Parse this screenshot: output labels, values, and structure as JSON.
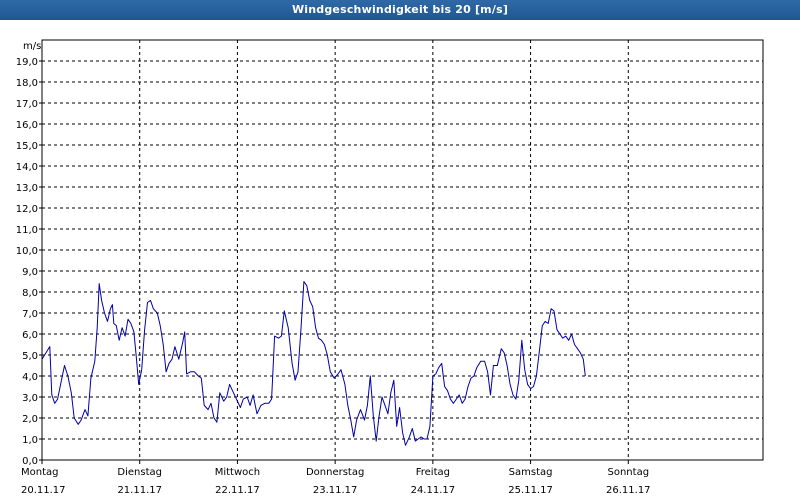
{
  "window": {
    "title": "Windgeschwindigkeit bis 20 [m/s]"
  },
  "colors": {
    "title_bar": "#1f5793",
    "series": "#0000aa",
    "grid": "#000000",
    "background": "#ffffff"
  },
  "chart_data": {
    "type": "line",
    "ylabel": "m/s",
    "ylim": [
      0,
      20
    ],
    "yticks": [
      "0,0",
      "1,0",
      "2,0",
      "3,0",
      "4,0",
      "5,0",
      "6,0",
      "7,0",
      "8,0",
      "9,0",
      "10,0",
      "11,0",
      "12,0",
      "13,0",
      "14,0",
      "15,0",
      "16,0",
      "17,0",
      "18,0",
      "19,0"
    ],
    "xlim": [
      0,
      7
    ],
    "xtick_days": [
      "Montag",
      "Dienstag",
      "Mittwoch",
      "Donnerstag",
      "Freitag",
      "Samstag",
      "Sonntag"
    ],
    "xtick_dates": [
      "20.11.17",
      "21.11.17",
      "22.11.17",
      "23.11.17",
      "24.11.17",
      "25.11.17",
      "26.11.17"
    ],
    "grid": true,
    "series": [
      {
        "values": [
          [
            0.0,
            4.8
          ],
          [
            0.04,
            5.1
          ],
          [
            0.08,
            5.4
          ],
          [
            0.1,
            3.1
          ],
          [
            0.13,
            2.7
          ],
          [
            0.16,
            2.9
          ],
          [
            0.19,
            3.6
          ],
          [
            0.23,
            4.5
          ],
          [
            0.265,
            4.0
          ],
          [
            0.3,
            3.2
          ],
          [
            0.33,
            2.0
          ],
          [
            0.37,
            1.7
          ],
          [
            0.4,
            1.9
          ],
          [
            0.44,
            2.4
          ],
          [
            0.47,
            2.1
          ],
          [
            0.5,
            3.9
          ],
          [
            0.54,
            4.7
          ],
          [
            0.565,
            6.3
          ],
          [
            0.585,
            8.4
          ],
          [
            0.61,
            7.6
          ],
          [
            0.64,
            7.0
          ],
          [
            0.67,
            6.6
          ],
          [
            0.7,
            7.2
          ],
          [
            0.72,
            7.4
          ],
          [
            0.735,
            6.5
          ],
          [
            0.76,
            6.4
          ],
          [
            0.79,
            5.7
          ],
          [
            0.82,
            6.3
          ],
          [
            0.85,
            5.9
          ],
          [
            0.88,
            6.7
          ],
          [
            0.91,
            6.5
          ],
          [
            0.94,
            6.1
          ],
          [
            0.965,
            4.9
          ],
          [
            0.99,
            3.6
          ],
          [
            1.02,
            4.3
          ],
          [
            1.05,
            6.2
          ],
          [
            1.08,
            7.5
          ],
          [
            1.11,
            7.6
          ],
          [
            1.14,
            7.2
          ],
          [
            1.18,
            7.0
          ],
          [
            1.21,
            6.4
          ],
          [
            1.24,
            5.5
          ],
          [
            1.27,
            4.2
          ],
          [
            1.3,
            4.6
          ],
          [
            1.33,
            4.8
          ],
          [
            1.36,
            5.4
          ],
          [
            1.4,
            4.8
          ],
          [
            1.44,
            5.6
          ],
          [
            1.46,
            6.1
          ],
          [
            1.48,
            4.1
          ],
          [
            1.52,
            4.2
          ],
          [
            1.56,
            4.2
          ],
          [
            1.6,
            4.0
          ],
          [
            1.63,
            3.9
          ],
          [
            1.66,
            2.6
          ],
          [
            1.7,
            2.4
          ],
          [
            1.73,
            2.7
          ],
          [
            1.76,
            2.0
          ],
          [
            1.79,
            1.8
          ],
          [
            1.82,
            3.2
          ],
          [
            1.86,
            2.8
          ],
          [
            1.89,
            3.0
          ],
          [
            1.92,
            3.6
          ],
          [
            1.96,
            3.2
          ],
          [
            2.0,
            2.8
          ],
          [
            2.03,
            2.5
          ],
          [
            2.06,
            2.9
          ],
          [
            2.1,
            3.0
          ],
          [
            2.13,
            2.6
          ],
          [
            2.16,
            3.1
          ],
          [
            2.2,
            2.2
          ],
          [
            2.24,
            2.6
          ],
          [
            2.28,
            2.7
          ],
          [
            2.32,
            2.7
          ],
          [
            2.35,
            2.9
          ],
          [
            2.38,
            5.9
          ],
          [
            2.42,
            5.8
          ],
          [
            2.45,
            5.9
          ],
          [
            2.48,
            7.1
          ],
          [
            2.52,
            6.3
          ],
          [
            2.56,
            4.6
          ],
          [
            2.59,
            3.8
          ],
          [
            2.62,
            4.2
          ],
          [
            2.65,
            6.2
          ],
          [
            2.68,
            8.5
          ],
          [
            2.71,
            8.3
          ],
          [
            2.74,
            7.6
          ],
          [
            2.77,
            7.3
          ],
          [
            2.8,
            6.3
          ],
          [
            2.83,
            5.8
          ],
          [
            2.86,
            5.7
          ],
          [
            2.89,
            5.5
          ],
          [
            2.92,
            5.0
          ],
          [
            2.95,
            4.2
          ],
          [
            2.99,
            3.9
          ],
          [
            3.03,
            4.1
          ],
          [
            3.06,
            4.3
          ],
          [
            3.1,
            3.6
          ],
          [
            3.13,
            2.6
          ],
          [
            3.16,
            1.9
          ],
          [
            3.19,
            1.1
          ],
          [
            3.22,
            1.9
          ],
          [
            3.26,
            2.4
          ],
          [
            3.3,
            1.9
          ],
          [
            3.33,
            2.6
          ],
          [
            3.36,
            4.0
          ],
          [
            3.39,
            2.1
          ],
          [
            3.42,
            0.9
          ],
          [
            3.45,
            2.1
          ],
          [
            3.48,
            3.0
          ],
          [
            3.51,
            2.6
          ],
          [
            3.54,
            2.2
          ],
          [
            3.57,
            3.2
          ],
          [
            3.6,
            3.8
          ],
          [
            3.63,
            1.6
          ],
          [
            3.66,
            2.5
          ],
          [
            3.69,
            1.3
          ],
          [
            3.72,
            0.7
          ],
          [
            3.76,
            1.1
          ],
          [
            3.79,
            1.5
          ],
          [
            3.82,
            0.9
          ],
          [
            3.85,
            1.0
          ],
          [
            3.88,
            1.1
          ],
          [
            3.91,
            1.0
          ],
          [
            3.94,
            1.0
          ],
          [
            3.97,
            1.6
          ],
          [
            4.0,
            4.0
          ],
          [
            4.03,
            4.1
          ],
          [
            4.06,
            4.4
          ],
          [
            4.09,
            4.6
          ],
          [
            4.12,
            3.5
          ],
          [
            4.15,
            3.3
          ],
          [
            4.18,
            2.9
          ],
          [
            4.21,
            2.7
          ],
          [
            4.24,
            2.9
          ],
          [
            4.27,
            3.1
          ],
          [
            4.3,
            2.7
          ],
          [
            4.33,
            2.9
          ],
          [
            4.36,
            3.5
          ],
          [
            4.39,
            3.9
          ],
          [
            4.42,
            4.0
          ],
          [
            4.45,
            4.4
          ],
          [
            4.49,
            4.7
          ],
          [
            4.53,
            4.7
          ],
          [
            4.56,
            4.2
          ],
          [
            4.59,
            3.1
          ],
          [
            4.62,
            4.5
          ],
          [
            4.66,
            4.5
          ],
          [
            4.7,
            5.3
          ],
          [
            4.73,
            5.1
          ],
          [
            4.76,
            4.5
          ],
          [
            4.79,
            3.6
          ],
          [
            4.82,
            3.1
          ],
          [
            4.85,
            2.9
          ],
          [
            4.88,
            3.8
          ],
          [
            4.91,
            5.7
          ],
          [
            4.94,
            4.3
          ],
          [
            4.97,
            3.6
          ],
          [
            5.0,
            3.4
          ],
          [
            5.03,
            3.5
          ],
          [
            5.06,
            4.0
          ],
          [
            5.09,
            5.2
          ],
          [
            5.12,
            6.4
          ],
          [
            5.15,
            6.6
          ],
          [
            5.18,
            6.5
          ],
          [
            5.21,
            7.2
          ],
          [
            5.24,
            7.1
          ],
          [
            5.27,
            6.2
          ],
          [
            5.3,
            6.0
          ],
          [
            5.33,
            5.8
          ],
          [
            5.36,
            5.9
          ],
          [
            5.39,
            5.7
          ],
          [
            5.42,
            6.0
          ],
          [
            5.45,
            5.5
          ],
          [
            5.48,
            5.3
          ],
          [
            5.51,
            5.1
          ],
          [
            5.54,
            4.8
          ],
          [
            5.56,
            4.0
          ]
        ]
      }
    ]
  }
}
